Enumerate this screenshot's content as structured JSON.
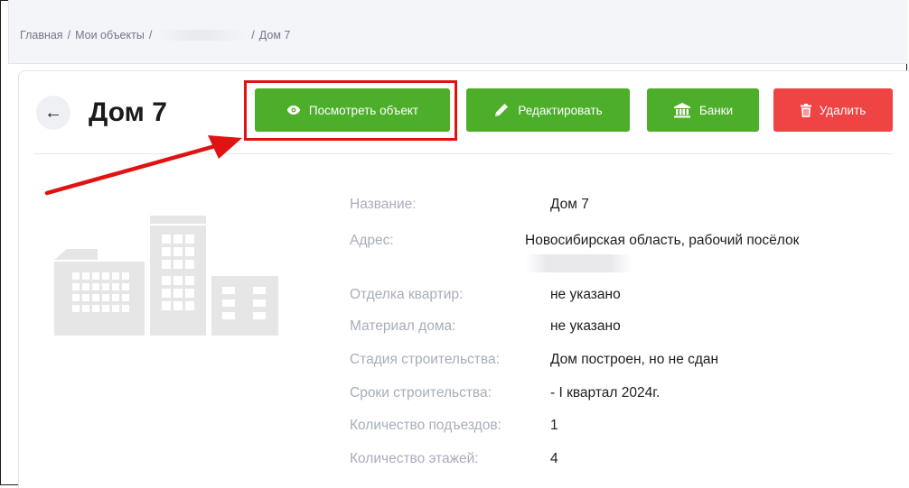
{
  "breadcrumb": {
    "home": "Главная",
    "objects": "Мои объекты",
    "current": "Дом 7",
    "separator": "/"
  },
  "header": {
    "back_icon": "arrow-left-icon",
    "title": "Дом 7"
  },
  "actions": {
    "view": {
      "label": "Посмотреть объект",
      "icon": "eye-icon",
      "color": "#4dae2a"
    },
    "edit": {
      "label": "Редактировать",
      "icon": "pencil-icon",
      "color": "#4dae2a"
    },
    "banks": {
      "label": "Банки",
      "icon": "bank-icon",
      "color": "#4dae2a"
    },
    "delete": {
      "label": "Удалить",
      "icon": "trash-icon",
      "color": "#ef4444"
    }
  },
  "annotation": {
    "color": "#e01212"
  },
  "details": [
    {
      "label": "Название:",
      "value": "Дом 7"
    },
    {
      "label": "Адрес:",
      "value": "Новосибирская область, рабочий посёлок"
    },
    {
      "label": "Отделка квартир:",
      "value": "не указано"
    },
    {
      "label": "Материал дома:",
      "value": "не указано"
    },
    {
      "label": "Стадия строительства:",
      "value": "Дом построен, но не сдан"
    },
    {
      "label": "Сроки строительства:",
      "value": "- I квартал 2024г."
    },
    {
      "label": "Количество подъездов:",
      "value": "1"
    },
    {
      "label": "Количество этажей:",
      "value": "4"
    }
  ]
}
